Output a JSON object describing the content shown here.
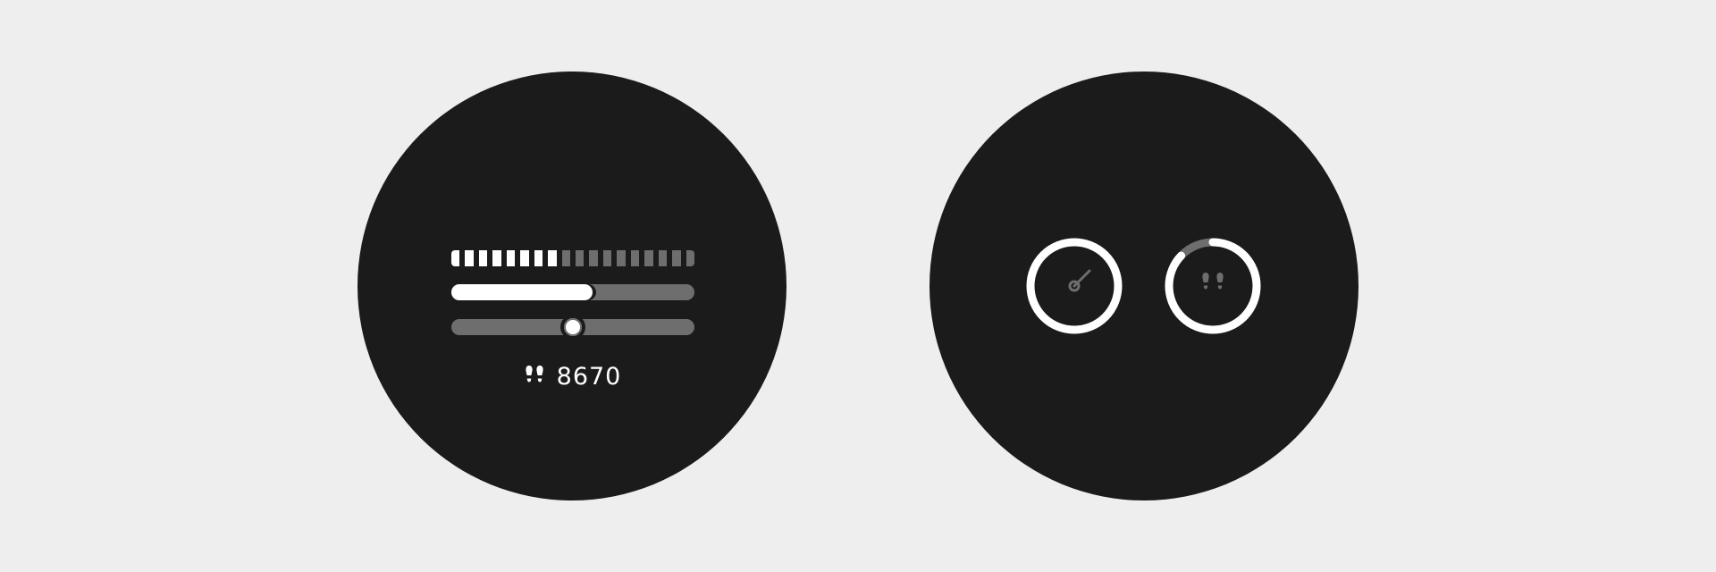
{
  "colors": {
    "background": "#eeeeee",
    "watch_face": "#1b1b1b",
    "active": "#ffffff",
    "inactive": "#6e6e6e"
  },
  "left_watch": {
    "segmented_bar": {
      "total_segments": 18,
      "filled_segments": 8
    },
    "progress_bar": {
      "fraction": 0.58
    },
    "slider": {
      "fraction": 0.5
    },
    "steps": {
      "icon": "footsteps-icon",
      "value": "8670"
    }
  },
  "right_watch": {
    "gauge": {
      "icon": "gauge-needle-icon",
      "ring_fraction": 1.0,
      "needle": "upper-right"
    },
    "steps_ring": {
      "icon": "footsteps-icon",
      "progress_fraction": 0.87
    }
  }
}
